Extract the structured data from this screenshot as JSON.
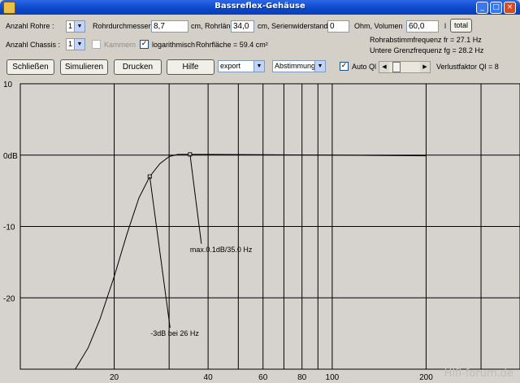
{
  "window": {
    "title": "Bassreflex-Gehäuse"
  },
  "controls": {
    "anzahl_rohre_label": "Anzahl Rohre :",
    "anzahl_rohre_value": "1",
    "rohrdurchmesser_label": "Rohrdurchmesser",
    "rohrdurchmesser_value": "8,7",
    "rohrlaenge_label": "cm, Rohrlänge",
    "rohrlaenge_value": "34,0",
    "serienwiderstand_label": "cm, Serienwiderstand",
    "serienwiderstand_value": "0",
    "volumen_label": "Ohm, Volumen",
    "volumen_value": "60,0",
    "volumen_unit": "l",
    "total_button": "total",
    "anzahl_chassis_label": "Anzahl Chassis :",
    "anzahl_chassis_value": "1",
    "kammern_label": "Kammern",
    "logarithmisch_label": "logarithmisch",
    "rohrflaeche_text": "Rohrfläche = 59.4 cm²",
    "rohrabstimm_text": "Rohrabstimmfrequenz fr = 27.1 Hz",
    "grenzfrequenz_text": "Untere Grenzfrequenz fg = 28.2 Hz",
    "schliessen_button": "Schließen",
    "simulieren_button": "Simulieren",
    "drucken_button": "Drucken",
    "hilfe_button": "Hilfe",
    "export_value": "export",
    "abstimmung_value": "Abstimmung",
    "auto_ql_label": "Auto Ql",
    "verlustfaktor_text": "Verlustfaktor Ql = 8"
  },
  "chart_data": {
    "type": "line",
    "x_scale": "log",
    "xlim": [
      10,
      400
    ],
    "ylim": [
      -30,
      10
    ],
    "x_ticks": [
      20,
      40,
      60,
      80,
      100,
      200
    ],
    "y_ticks": [
      {
        "value": 10,
        "label": "10"
      },
      {
        "value": 0,
        "label": "0dB"
      },
      {
        "value": -10,
        "label": "-10"
      },
      {
        "value": -20,
        "label": "-20"
      }
    ],
    "grid": true,
    "series": [
      {
        "x": [
          15,
          16.5,
          18,
          20,
          22,
          24,
          26,
          28,
          30,
          32,
          34,
          35,
          40,
          60,
          100,
          200
        ],
        "y": [
          -30,
          -27,
          -23,
          -17,
          -11,
          -6,
          -3,
          -1.2,
          -0.2,
          0.1,
          0.1,
          0.1,
          0.1,
          0.05,
          0,
          -0.1
        ]
      }
    ],
    "annotations": [
      {
        "text": "max.0.1dB/35.0 Hz",
        "x": 35.0,
        "y": 0.1
      },
      {
        "text": "-3dB bei  26 Hz",
        "x": 26,
        "y": -3
      }
    ],
    "watermark": "Hifi-forum.de"
  }
}
